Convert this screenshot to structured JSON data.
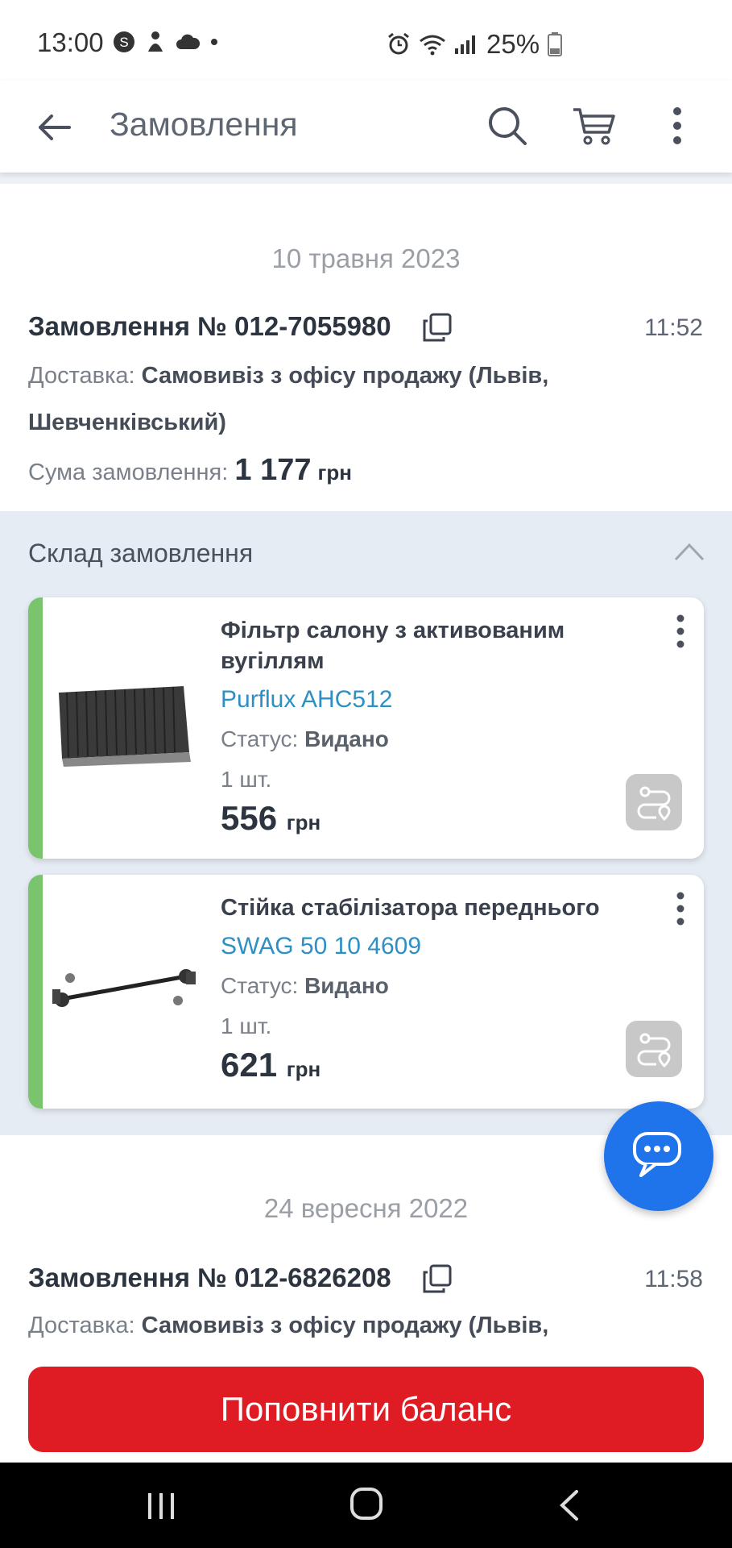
{
  "status_bar": {
    "time": "13:00",
    "battery": "25%",
    "icons": [
      "samsung-s-icon",
      "notification-icon",
      "cloud-icon",
      "dot-icon",
      "alarm-icon",
      "wifi-icon",
      "signal-icon",
      "battery-icon"
    ]
  },
  "app_bar": {
    "title": "Замовлення"
  },
  "orders": [
    {
      "date": "10 травня 2023",
      "title": "Замовлення № 012-7055980",
      "time": "11:52",
      "delivery_label": "Доставка:",
      "delivery_value_line1": "Самовивіз з офісу продажу (Львів,",
      "delivery_value_line2": "Шевченківський)",
      "sum_label": "Сума замовлення:",
      "sum_value": "1 177",
      "sum_currency": "грн"
    },
    {
      "date": "24 вересня 2022",
      "title": "Замовлення № 012-6826208",
      "time": "11:58",
      "delivery_label": "Доставка:",
      "delivery_value_line1": "Самовивіз з офісу продажу (Львів,"
    }
  ],
  "composition": {
    "title": "Склад замовлення",
    "items": [
      {
        "name": "Фільтр салону з активованим вугіллям",
        "brand": "Purflux AHC512",
        "status_label": "Статус:",
        "status_value": "Видано",
        "qty": "1 шт.",
        "price": "556",
        "currency": "грн"
      },
      {
        "name": "Стійка стабілізатора переднього",
        "brand": "SWAG 50 10 4609",
        "status_label": "Статус:",
        "status_value": "Видано",
        "qty": "1 шт.",
        "price": "621",
        "currency": "грн"
      }
    ]
  },
  "balance_button": "Поповнити баланс",
  "colors": {
    "accent_blue": "#1f74ec",
    "brand_link": "#2e8fc4",
    "button_red": "#df1b24",
    "status_green": "#7ac46e"
  }
}
